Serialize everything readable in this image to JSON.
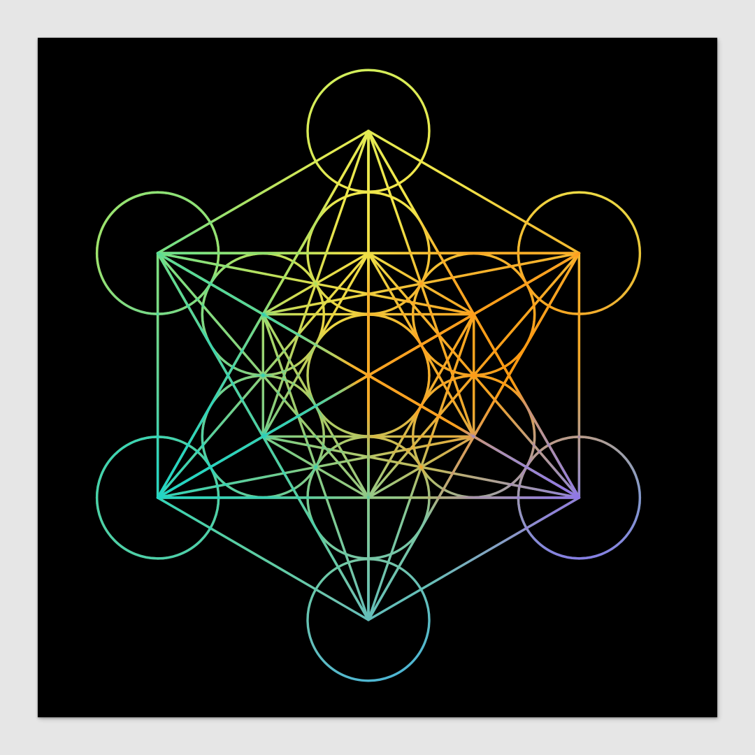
{
  "scene": {
    "wall_color": "#e6e6e6",
    "poster_background": "#000000",
    "motif": "metatrons-cube",
    "stroke_gradient": {
      "top": "#e8ec40",
      "upper_left": "#7be07c",
      "right": "#ff9a14",
      "lower_left": "#2bd6c6",
      "bottom": "#3aaee8",
      "lower_right": "#8c6cf0"
    }
  }
}
